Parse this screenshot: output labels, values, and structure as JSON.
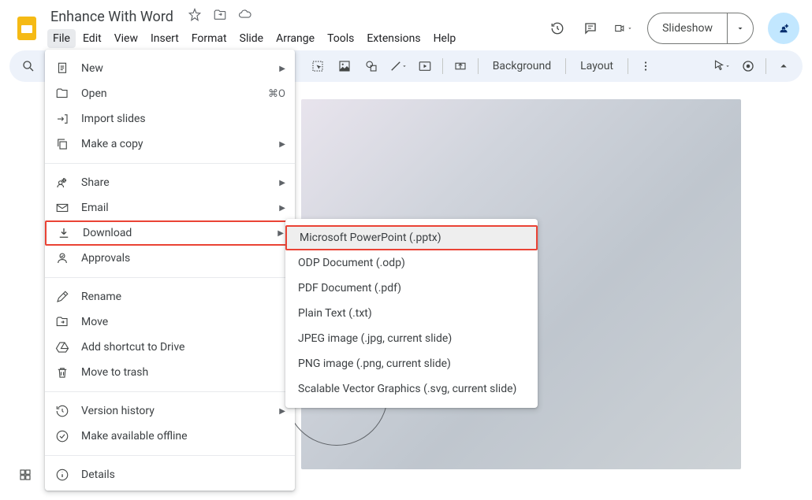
{
  "doc": {
    "title": "Enhance With Word"
  },
  "menus": {
    "file": "File",
    "edit": "Edit",
    "view": "View",
    "insert": "Insert",
    "format": "Format",
    "slide": "Slide",
    "arrange": "Arrange",
    "tools": "Tools",
    "extensions": "Extensions",
    "help": "Help"
  },
  "header": {
    "slideshow": "Slideshow"
  },
  "toolbar": {
    "background": "Background",
    "layout": "Layout"
  },
  "file_menu": {
    "new": "New",
    "open": "Open",
    "open_shortcut": "⌘O",
    "import_slides": "Import slides",
    "make_copy": "Make a copy",
    "share": "Share",
    "email": "Email",
    "download": "Download",
    "approvals": "Approvals",
    "rename": "Rename",
    "move": "Move",
    "add_shortcut": "Add shortcut to Drive",
    "move_trash": "Move to trash",
    "version_history": "Version history",
    "offline": "Make available offline",
    "details": "Details"
  },
  "download_menu": {
    "pptx": "Microsoft PowerPoint (.pptx)",
    "odp": "ODP Document (.odp)",
    "pdf": "PDF Document (.pdf)",
    "txt": "Plain Text (.txt)",
    "jpg": "JPEG image (.jpg, current slide)",
    "png": "PNG image (.png, current slide)",
    "svg": "Scalable Vector Graphics (.svg, current slide)"
  }
}
